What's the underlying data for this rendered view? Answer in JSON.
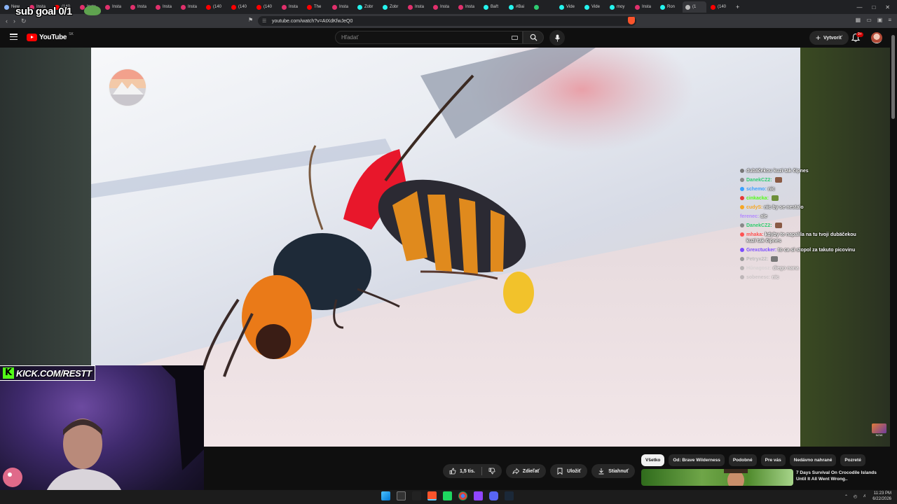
{
  "overlay": {
    "sub_goal": "sub goal 0/1",
    "kick_url": "KICK.COM/RESTT",
    "kick_logo": "K"
  },
  "browser": {
    "tabs": [
      {
        "label": "New",
        "color": "#8ab4f8"
      },
      {
        "label": "Insta",
        "color": "#e1306c"
      },
      {
        "label": "(140",
        "color": "#ff0000"
      },
      {
        "label": "Insta",
        "color": "#e1306c"
      },
      {
        "label": "Insta",
        "color": "#e1306c"
      },
      {
        "label": "Insta",
        "color": "#e1306c"
      },
      {
        "label": "Insta",
        "color": "#e1306c"
      },
      {
        "label": "Insta",
        "color": "#e1306c"
      },
      {
        "label": "(140",
        "color": "#ff0000"
      },
      {
        "label": "(140",
        "color": "#ff0000"
      },
      {
        "label": "(140",
        "color": "#ff0000"
      },
      {
        "label": "Insta",
        "color": "#e1306c"
      },
      {
        "label": "The",
        "color": "#ff0000"
      },
      {
        "label": "Insta",
        "color": "#e1306c"
      },
      {
        "label": "Zobr",
        "color": "#25f4ee"
      },
      {
        "label": "Zobr",
        "color": "#25f4ee"
      },
      {
        "label": "Insta",
        "color": "#e1306c"
      },
      {
        "label": "Insta",
        "color": "#e1306c"
      },
      {
        "label": "Insta",
        "color": "#e1306c"
      },
      {
        "label": "Bařt",
        "color": "#25f4ee"
      },
      {
        "label": "#Bai",
        "color": "#25f4ee"
      },
      {
        "label": "",
        "color": "#2ecc71"
      },
      {
        "label": "Vide",
        "color": "#25f4ee"
      },
      {
        "label": "Vide",
        "color": "#25f4ee"
      },
      {
        "label": "moy",
        "color": "#25f4ee"
      },
      {
        "label": "Insta",
        "color": "#e1306c"
      },
      {
        "label": "Ron",
        "color": "#25f4ee"
      },
      {
        "label": "(1",
        "color": "#bbbbbb"
      },
      {
        "label": "(140",
        "color": "#ff0000"
      }
    ],
    "new_tab": "+",
    "url": "youtube.com/watch?v=AtXdKfwJeQ0"
  },
  "youtube": {
    "logo_text": "YouTube",
    "region": "SK",
    "search_placeholder": "Hľadať",
    "create_label": "Vytvoriť",
    "notif_count": "9+",
    "actions": {
      "likes": "1,5 tis.",
      "share": "Zdieľať",
      "save": "Uložiť",
      "download": "Stiahnuť",
      "more": "···"
    },
    "chips": [
      "Všetko",
      "Od: Brave Wilderness",
      "Podobné",
      "Pre vás",
      "Nedávno nahrané",
      "Pozreté"
    ],
    "recommendation": {
      "title": "7 Days Survival On Crocodile Islands Until It All Went Wrong..",
      "title_line1": "7 Days Survival On Crocodile Islands",
      "title_line2": "Until It All Went Wrong.."
    }
  },
  "chat": [
    {
      "nick": "",
      "msg": "dubäčekou kuzi tak čipnes",
      "nick_color": "#ffffff",
      "badge": "#777"
    },
    {
      "nick": "DanekCZ2:",
      "msg": "",
      "nick_color": "#2ecc71",
      "badge": "#888",
      "emote": "#8a5a44"
    },
    {
      "nick": "schemo:",
      "msg": "nic",
      "nick_color": "#3aa0ff",
      "badge": "#3aa0ff"
    },
    {
      "nick": "cinkacka:",
      "msg": "",
      "nick_color": "#53fc18",
      "badge": "#e53935",
      "emote": "#6d8f3a"
    },
    {
      "nick": "cudyS:",
      "msg": "nic by se nestalo",
      "nick_color": "#f5a623",
      "badge": "#f5a623"
    },
    {
      "nick": "ferenec:",
      "msg": "ale",
      "nick_color": "#b388ff",
      "badge": ""
    },
    {
      "nick": "DanekCZ2:",
      "msg": "",
      "nick_color": "#2ecc71",
      "badge": "#888",
      "emote": "#8a5a44"
    },
    {
      "nick": "mhaka:",
      "msg": "kdyby te napalila na tu tvoji dubäčekou kuzi tak čipnes",
      "nick_color": "#ff5252",
      "badge": "#ff5252"
    },
    {
      "nick": "Grexctucker:",
      "msg": "to ca si stopol za takuto picovinu",
      "nick_color": "#7c4dff",
      "badge": "#7c4dff"
    },
    {
      "nick": "Petryx22:",
      "msg": "",
      "nick_color": "#bbbbbb",
      "badge": "#999",
      "emote": "#777"
    },
    {
      "nick": "Hűnagosz:",
      "msg": "diego nana",
      "nick_color": "#cccccc",
      "badge": "#999"
    },
    {
      "nick": "sobenesc:",
      "msg": "nic",
      "nick_color": "#aaaaaa",
      "badge": "#888"
    }
  ],
  "now_badge": {
    "top": "WATCHING",
    "label": "NOW"
  },
  "taskbar": {
    "time": "11:23 PM",
    "date": "6/22/2026"
  },
  "colors": {
    "accent": "#ff0000",
    "kick_green": "#53fc18",
    "brave": "#fb542b"
  }
}
